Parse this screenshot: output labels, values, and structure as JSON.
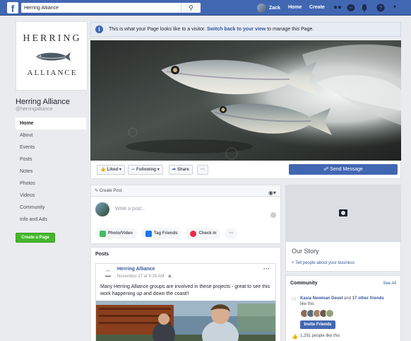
{
  "topbar": {
    "logo": "f",
    "search_value": "Herring Alliance",
    "user_name": "Zack",
    "home_label": "Home",
    "create_label": "Create"
  },
  "left": {
    "logo_top": "HERRING",
    "logo_bottom": "ALLIANCE",
    "page_name": "Herring Alliance",
    "handle": "@herringalliance",
    "nav": [
      "Home",
      "About",
      "Events",
      "Posts",
      "Notes",
      "Photos",
      "Videos",
      "Community",
      "Info and Ads"
    ],
    "create_page": "Create a Page"
  },
  "notice": {
    "text_before": "This is what your Page looks like to a visitor.",
    "link": "Switch back to your view",
    "text_after": "to manage this Page."
  },
  "actions": {
    "liked": "Liked",
    "following": "Following",
    "share": "Share",
    "more": "···",
    "send_message": "Send Message"
  },
  "create_post": {
    "header": "Create Post",
    "placeholder": "Write a post...",
    "options": [
      "Photo/Video",
      "Tag Friends",
      "Check in",
      "···"
    ]
  },
  "posts": {
    "title": "Posts",
    "author": "Herring Alliance",
    "time": "November 27 at 9:39 AM ·",
    "more": "···",
    "text": "Many Herring Alliance groups are involved in these projects - great to see this work happening up and down the coast!!"
  },
  "story": {
    "title": "Our Story",
    "link": "+ Tell people about your business"
  },
  "community": {
    "title": "Community",
    "see_all": "See All",
    "friend_name": "Kasia Newman Deuel",
    "and_text": "and",
    "others": "17 other friends",
    "like_this": "like this",
    "invite": "Invite Friends",
    "likes": "1,291 people like this"
  },
  "colors": {
    "brand": "#4267b2",
    "link": "#365899",
    "green": "#42b72a",
    "background": "#e9ebee"
  }
}
